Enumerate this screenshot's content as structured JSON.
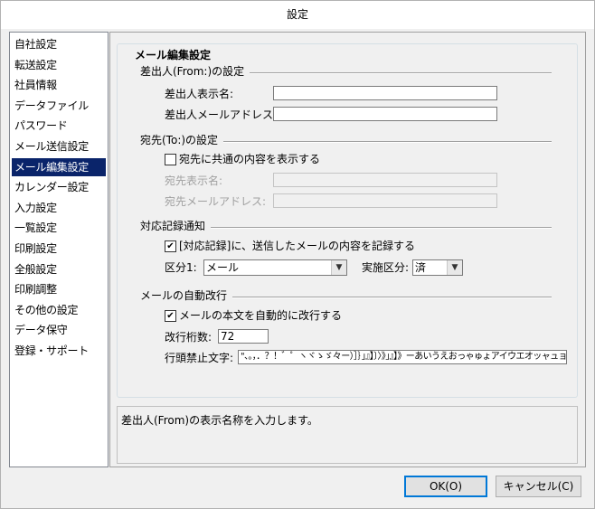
{
  "window": {
    "title": "設定"
  },
  "nav": {
    "items": [
      {
        "label": "自社設定",
        "selected": false
      },
      {
        "label": "転送設定",
        "selected": false
      },
      {
        "label": "社員情報",
        "selected": false
      },
      {
        "label": "データファイル",
        "selected": false
      },
      {
        "label": "パスワード",
        "selected": false
      },
      {
        "label": "メール送信設定",
        "selected": false
      },
      {
        "label": "メール編集設定",
        "selected": true
      },
      {
        "label": "カレンダー設定",
        "selected": false
      },
      {
        "label": "入力設定",
        "selected": false
      },
      {
        "label": "一覧設定",
        "selected": false
      },
      {
        "label": "印刷設定",
        "selected": false
      },
      {
        "label": "全般設定",
        "selected": false
      },
      {
        "label": "印刷調整",
        "selected": false
      },
      {
        "label": "その他の設定",
        "selected": false
      },
      {
        "label": "データ保守",
        "selected": false
      },
      {
        "label": "登録・サポート",
        "selected": false
      }
    ]
  },
  "main": {
    "group_title": "メール編集設定",
    "from": {
      "section": "差出人(From:)の設定",
      "name_label": "差出人表示名:",
      "name_value": "",
      "address_label": "差出人メールアドレス:",
      "address_value": ""
    },
    "to": {
      "section": "宛先(To:)の設定",
      "common_checkbox_label": "宛先に共通の内容を表示する",
      "common_checked": false,
      "name_label": "宛先表示名:",
      "name_value": "",
      "address_label": "宛先メールアドレス:",
      "address_value": ""
    },
    "record": {
      "section": "対応記録通知",
      "checkbox_label": "[対応記録]に、送信したメールの内容を記録する",
      "checked": true,
      "kubun1_label": "区分1:",
      "kubun1_value": "メール",
      "jisshi_label": "実施区分:",
      "jisshi_value": "済"
    },
    "wrap": {
      "section": "メールの自動改行",
      "checkbox_label": "メールの本文を自動的に改行する",
      "checked": true,
      "columns_label": "改行桁数:",
      "columns_value": "72",
      "kinsoku_label": "行頭禁止文字:",
      "kinsoku_value": "\"、。，．？！゛゜ヽヾゝゞ々ー）］｝」』】〕〉》」』】》ーあいうえおっゃゅょアイウエオッャュョ"
    },
    "help_text": "差出人(From)の表示名称を入力します。"
  },
  "buttons": {
    "ok_label": "OK(O)",
    "cancel_label": "キャンセル(C)"
  },
  "icons": {
    "checkbox_checked": "check-icon",
    "combo_arrow": "chevron-down-icon"
  }
}
